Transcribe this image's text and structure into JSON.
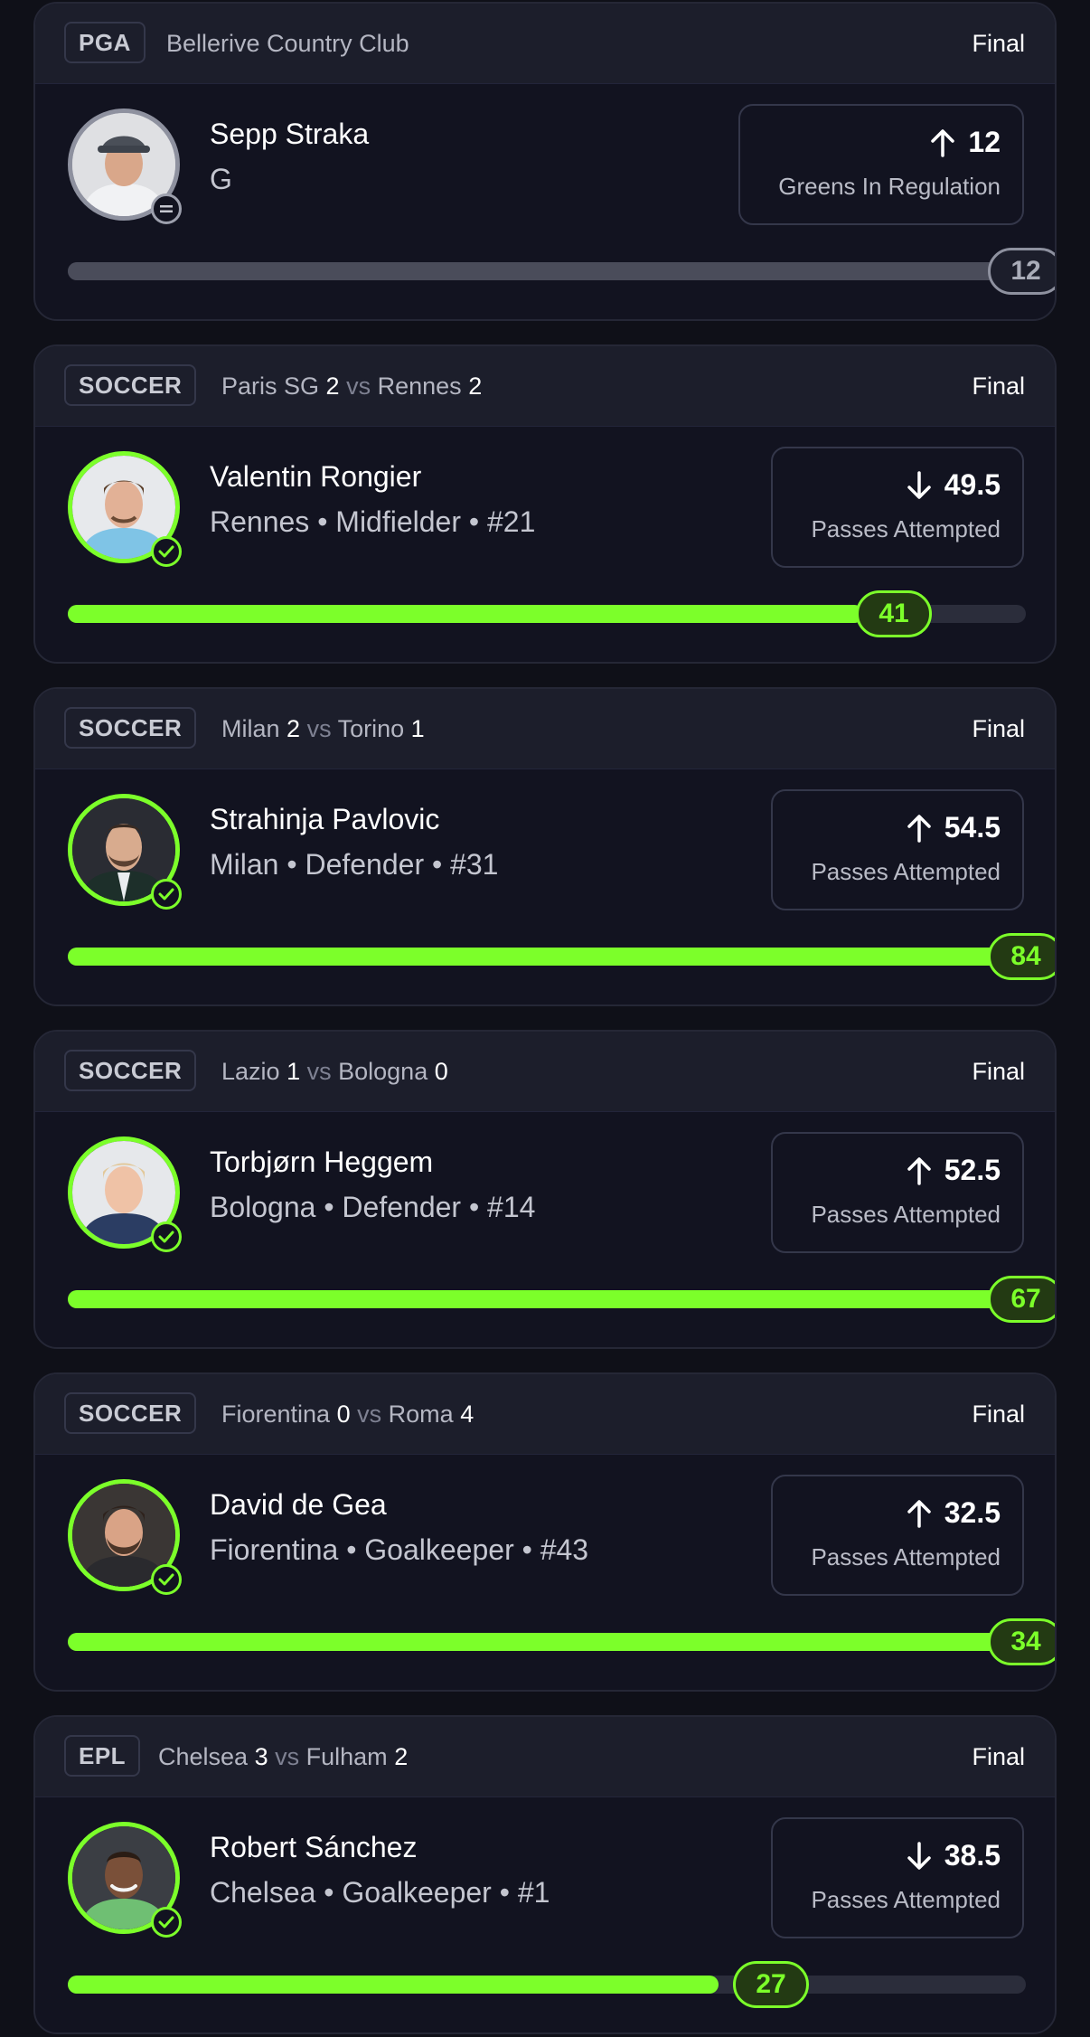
{
  "cards": [
    {
      "league": "PGA",
      "match": {
        "venue": "Bellerive Country Club"
      },
      "status": "Final",
      "player": {
        "name": "Sepp Straka",
        "meta": "G",
        "avatar": "golfer-photo"
      },
      "prop": {
        "direction": "up",
        "line": "12",
        "stat": "Greens In Regulation"
      },
      "result": {
        "value": "12",
        "progress": 1.0,
        "state": "push"
      }
    },
    {
      "league": "SOCCER",
      "match": {
        "home": "Paris SG",
        "home_score": "2",
        "vs": "vs",
        "away": "Rennes",
        "away_score": "2"
      },
      "status": "Final",
      "player": {
        "name": "Valentin Rongier",
        "meta": "Rennes • Midfielder • #21",
        "avatar": "player-photo"
      },
      "prop": {
        "direction": "down",
        "line": "49.5",
        "stat": "Passes Attempted"
      },
      "result": {
        "value": "41",
        "progress": 0.83,
        "state": "win"
      }
    },
    {
      "league": "SOCCER",
      "match": {
        "home": "Milan",
        "home_score": "2",
        "vs": "vs",
        "away": "Torino",
        "away_score": "1"
      },
      "status": "Final",
      "player": {
        "name": "Strahinja Pavlovic",
        "meta": "Milan • Defender • #31",
        "avatar": "player-photo"
      },
      "prop": {
        "direction": "up",
        "line": "54.5",
        "stat": "Passes Attempted"
      },
      "result": {
        "value": "84",
        "progress": 1.0,
        "state": "win"
      }
    },
    {
      "league": "SOCCER",
      "match": {
        "home": "Lazio",
        "home_score": "1",
        "vs": "vs",
        "away": "Bologna",
        "away_score": "0"
      },
      "status": "Final",
      "player": {
        "name": "Torbjørn Heggem",
        "meta": "Bologna • Defender • #14",
        "avatar": "player-photo"
      },
      "prop": {
        "direction": "up",
        "line": "52.5",
        "stat": "Passes Attempted"
      },
      "result": {
        "value": "67",
        "progress": 1.0,
        "state": "win"
      }
    },
    {
      "league": "SOCCER",
      "match": {
        "home": "Fiorentina",
        "home_score": "0",
        "vs": "vs",
        "away": "Roma",
        "away_score": "4"
      },
      "status": "Final",
      "player": {
        "name": "David de Gea",
        "meta": "Fiorentina • Goalkeeper • #43",
        "avatar": "player-photo"
      },
      "prop": {
        "direction": "up",
        "line": "32.5",
        "stat": "Passes Attempted"
      },
      "result": {
        "value": "34",
        "progress": 1.0,
        "state": "win"
      }
    },
    {
      "league": "EPL",
      "match": {
        "home": "Chelsea",
        "home_score": "3",
        "vs": "vs",
        "away": "Fulham",
        "away_score": "2"
      },
      "status": "Final",
      "player": {
        "name": "Robert Sánchez",
        "meta": "Chelsea • Goalkeeper • #1",
        "avatar": "player-photo"
      },
      "prop": {
        "direction": "down",
        "line": "38.5",
        "stat": "Passes Attempted"
      },
      "result": {
        "value": "27",
        "progress": 0.68,
        "state": "win"
      }
    }
  ],
  "colors": {
    "accent": "#7cff2a",
    "card_bg": "#121320",
    "header_bg": "#1c1e2b",
    "page_bg": "#0f1018"
  },
  "icons": {
    "up": "arrow-up-icon",
    "down": "arrow-down-icon",
    "win": "check-icon",
    "push": "equals-icon"
  }
}
